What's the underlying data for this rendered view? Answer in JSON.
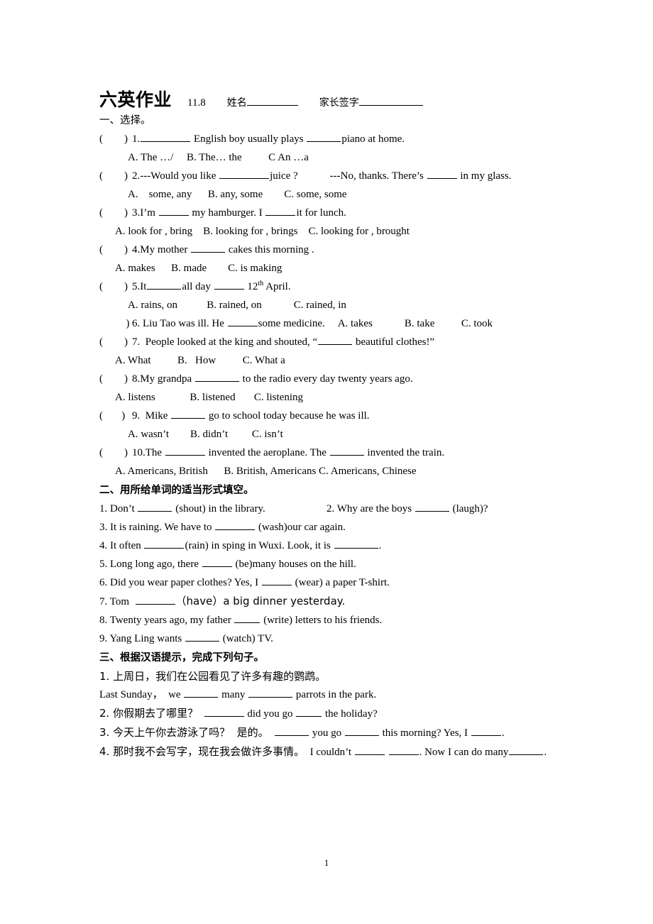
{
  "header": {
    "title": "六英作业",
    "date": "11.8",
    "name_label": "姓名",
    "signature_label": "家长签字"
  },
  "section1": {
    "heading": "一、选择。",
    "questions": [
      {
        "num": "1.",
        "stem_pre": "",
        "stem": " English boy usually plays ",
        "stem_post": "piano at home.",
        "options": "A. The …/     B. The… the          C An …a",
        "has_open_paren": true
      },
      {
        "num": "2.",
        "stem": "---Would you like ",
        "stem_post": "juice ?            ---No, thanks. There’s ",
        "stem_tail": " in my glass.",
        "options": "A.    some, any      B. any, some        C. some, some",
        "has_open_paren": true
      },
      {
        "num": "3.",
        "stem": "I’m ",
        "stem_post": " my hamburger. I ",
        "stem_tail": "it for lunch.",
        "options": "A. look for , bring    B. looking for , brings    C. looking for , brought",
        "has_open_paren": true
      },
      {
        "num": "4.",
        "stem": "My mother ",
        "stem_post": " cakes this morning .",
        "options": "A. makes      B. made        C. is making",
        "has_open_paren": true
      },
      {
        "num": "5.",
        "stem": "It",
        "stem_post": "all day ",
        "stem_tail": " 12",
        "sup": "th",
        "stem_tail2": " April.",
        "options": "A. rains, on           B. rained, on            C. rained, in",
        "has_open_paren": true
      },
      {
        "num": "6.",
        "stem": "Liu Tao was ill. He ",
        "stem_post": "some medicine.     A. takes            B. take          C. took",
        "has_open_paren": false
      },
      {
        "num": "7.",
        "stem": "  People looked at the king and shouted, “",
        "stem_post": " beautiful clothes!”",
        "options": "A. What          B.   How          C. What a",
        "has_open_paren": true
      },
      {
        "num": "8.",
        "stem": "My grandpa ",
        "stem_post": " to the radio every day twenty years ago.",
        "options": "A. listens             B. listened       C. listening",
        "has_open_paren": true
      },
      {
        "num": "9.",
        "stem": "  Mike ",
        "stem_post": " go to school today because he was ill.",
        "options": "A. wasn’t        B. didn’t         C. isn’t",
        "has_open_paren": true
      },
      {
        "num": "10.",
        "stem": "The ",
        "stem_post": " invented the aeroplane. The ",
        "stem_tail": " invented the train.",
        "options": "A. Americans, British      B. British, Americans C. Americans, Chinese",
        "has_open_paren": true
      }
    ]
  },
  "section2": {
    "heading": "二、用所给单词的适当形式填空。",
    "items": [
      {
        "pre": "1. Don’t ",
        "post": " (shout) in the library.                       2. Why are the boys ",
        "tail": " (laugh)?"
      },
      {
        "pre": "3. It is raining. We have to ",
        "post": " (wash)our car again."
      },
      {
        "pre": "4. It often ",
        "post": "(rain) in sping in Wuxi. Look, it is ",
        "tail": "."
      },
      {
        "pre": "5. Long long ago, there ",
        "post": " (be)many houses on the hill."
      },
      {
        "pre": "6. Did you wear paper clothes? Yes, I ",
        "post": " (wear) a paper T-shirt."
      },
      {
        "pre": "7. Tom  ",
        "post": "（have）a big dinner yesterday."
      },
      {
        "pre": "8. Twenty years ago, my father ",
        "post": " (write) letters to his friends."
      },
      {
        "pre": "9. Yang Ling wants ",
        "post": " (watch) TV."
      }
    ]
  },
  "section3": {
    "heading": "三、根据汉语提示，完成下列句子。",
    "items": [
      {
        "chinese": "1. 上周日，我们在公园看见了许多有趣的鹦鹉。",
        "en_pre": "Last Sunday，  we ",
        "en_mid": " many ",
        "en_tail": " parrots in the park."
      },
      {
        "chinese": "2. 你假期去了哪里？",
        "en_pre": "  ",
        "en_mid": " did you go ",
        "en_tail": " the holiday?"
      },
      {
        "chinese": "3. 今天上午你去游泳了吗？  是的。",
        "en_pre": "  ",
        "en_mid": " you go ",
        "en_tail": " this morning? Yes, I ",
        "en_tail2": "."
      },
      {
        "chinese": "4. 那时我不会写字，现在我会做许多事情。",
        "en_pre": "  I couldn’t ",
        "en_mid": " ",
        "en_tail": ". Now I can do many",
        "en_tail2": "."
      }
    ]
  },
  "footer": {
    "page_number": "1"
  }
}
